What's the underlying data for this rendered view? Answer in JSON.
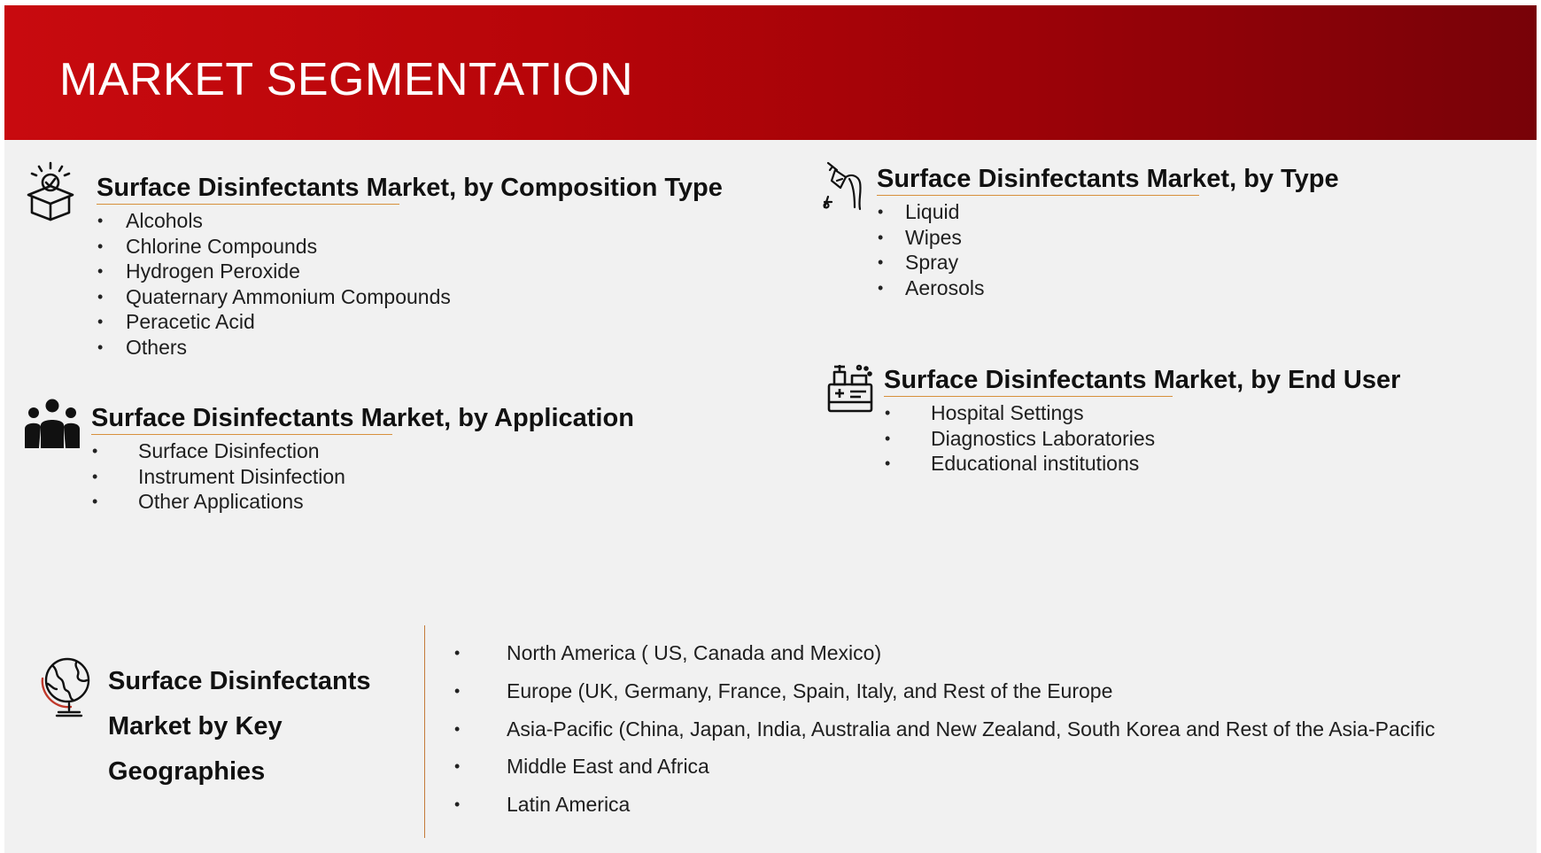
{
  "header": {
    "title": "MARKET SEGMENTATION"
  },
  "composition": {
    "title": "Surface Disinfectants Market, by Composition  Type",
    "items": [
      "Alcohols",
      "Chlorine Compounds",
      "Hydrogen Peroxide",
      "Quaternary Ammonium  Compounds",
      "Peracetic Acid",
      "Others"
    ]
  },
  "type": {
    "title": "Surface Disinfectants Market, by  Type",
    "items": [
      "Liquid",
      "Wipes",
      "Spray",
      "Aerosols"
    ]
  },
  "application": {
    "title": "Surface Disinfectants Market, by Application",
    "items": [
      "Surface Disinfection",
      "Instrument Disinfection",
      "Other Applications"
    ]
  },
  "end_user": {
    "title": "Surface Disinfectants Market, by End User",
    "items": [
      "Hospital Settings",
      "Diagnostics Laboratories",
      "Educational institutions"
    ]
  },
  "geography": {
    "title_lines": [
      "Surface Disinfectants",
      "Market by Key",
      "Geographies"
    ],
    "items": [
      "North America ( US, Canada and Mexico)",
      "Europe (UK, Germany, France, Spain, Italy, and Rest of the Europe",
      "Asia-Pacific (China, Japan, India, Australia and New Zealand, South Korea and Rest of the Asia-Pacific",
      "Middle East and Africa",
      "Latin America"
    ]
  },
  "bullet_char": "•",
  "colors": {
    "banner_start": "#c80a0f",
    "banner_end": "#780208",
    "underline": "#d7903c",
    "background": "#f1f1f1"
  },
  "icons": [
    "box-check-icon",
    "syringe-icon",
    "people-group-icon",
    "medical-kit-icon",
    "globe-icon"
  ]
}
